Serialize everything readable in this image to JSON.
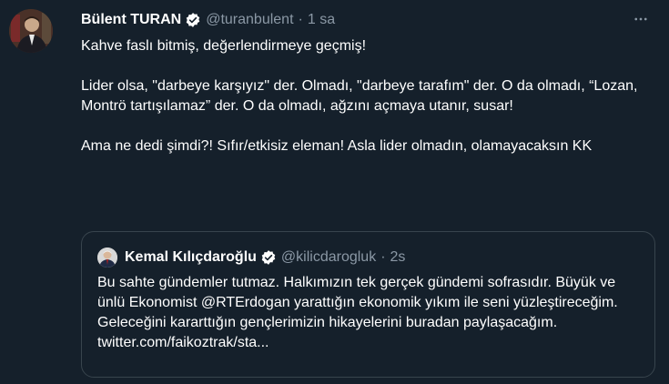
{
  "tweet": {
    "author_name": "Bülent TURAN",
    "author_handle": "@turanbulent",
    "separator": "·",
    "time": "1 sa",
    "more_icon": "ellipsis-icon",
    "verified_color": "#ffffff",
    "lines": [
      "Kahve faslı bitmiş, değerlendirmeye geçmiş!",
      "",
      "Lider olsa, \"darbeye karşıyız\" der. Olmadı, \"darbeye tarafım\" der. O da olmadı, “Lozan, Montrö tartışılamaz” der. O da olmadı, ağzını açmaya utanır, susar!",
      "",
      "Ama ne dedi şimdi?! Sıfır/etkisiz eleman! Asla lider olmadın, olamayacaksın KK"
    ]
  },
  "quote": {
    "author_name": "Kemal Kılıçdaroğlu",
    "author_handle": "@kilicdarogluk",
    "separator": "·",
    "time": "2s",
    "text": "Bu sahte gündemler tutmaz. Halkımızın tek gerçek gündemi sofrasıdır. Büyük ve ünlü Ekonomist @RTErdogan yarattığın ekonomik yıkım ile seni yüzleştireceğim. Geleceğini kararttığın gençlerimizin hikayelerini buradan paylaşacağım. twitter.com/faikoztrak/sta..."
  },
  "colors": {
    "background": "#15202b",
    "text": "#ffffff",
    "muted": "#8b98a5",
    "border": "#38444d"
  }
}
